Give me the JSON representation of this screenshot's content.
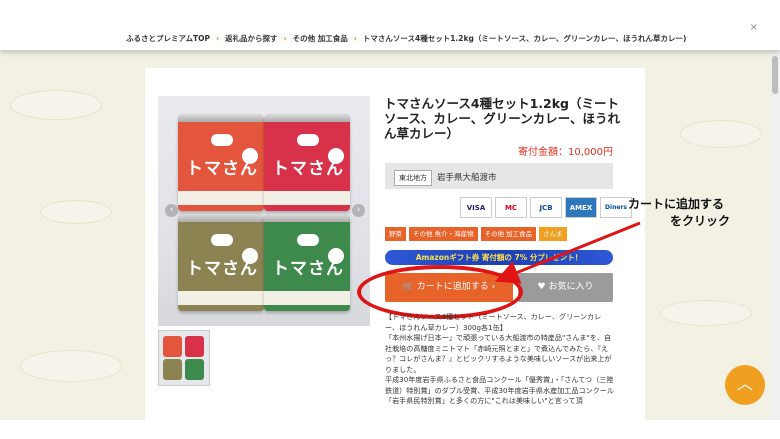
{
  "breadcrumb": {
    "items": [
      "ふるさとプレミアムTOP",
      "返礼品から探す",
      "その他 加工食品",
      "トマさんソース4種セット1.2kg（ミートソース、カレー、グリーンカレー、ほうれん草カレー)"
    ],
    "sep": "›"
  },
  "window": {
    "close": "×"
  },
  "product": {
    "title": "トマさんソース4種セット1.2kg（ミートソース、カレー、グリーンカレー、ほうれん草カレー）",
    "price": "寄付金額：10,000円",
    "can_logo": "トマさん",
    "region_label": "東北地方",
    "region_name": "岩手県大船渡市",
    "cards": [
      "VISA",
      "MC",
      "JCB",
      "AMEX",
      "Diners"
    ],
    "tags": [
      "野菜",
      "その他 魚介・海産物",
      "その他 加工食品",
      "さんま"
    ],
    "amazon_banner": "Amazonギフト券 寄付額の 7% 分プレゼント！",
    "cart_button": "カートに追加する",
    "fav_button": "お気に入り",
    "carousel_prev": "‹",
    "carousel_next": "›",
    "description": [
      "【トマさんソース4種セット（ミートソース、カレー、グリーンカレー、ほうれん草カレー）300g各1缶】",
      "「本州水揚げ日本一」で頑張っている大船渡市の特産品\"さんま\"を、自社栽培の高糖度ミニトマト「赤崎元照とまと」で煮込んでみたら、『えっ？コレがさんま？』とビックリするような美味しいソースが出来上がりました。",
      "平成30年度岩手県ふるさと食品コンクール「優秀賞」・「さんてつ（三陸鉄道）特別賞」のダブル受賞、平成30年度岩手県水産加工品コンクール「岩手県民特別賞」と多くの方に\"これは美味しい\"と言って頂"
    ]
  },
  "annotation": {
    "line1": "カートに追加する",
    "line2": "をクリック",
    "color": "#e01414"
  },
  "scroll_top_icon": "︿",
  "colors": {
    "accent": "#e8632a",
    "price": "#e0301e",
    "amazon": "#1b3fb6"
  }
}
